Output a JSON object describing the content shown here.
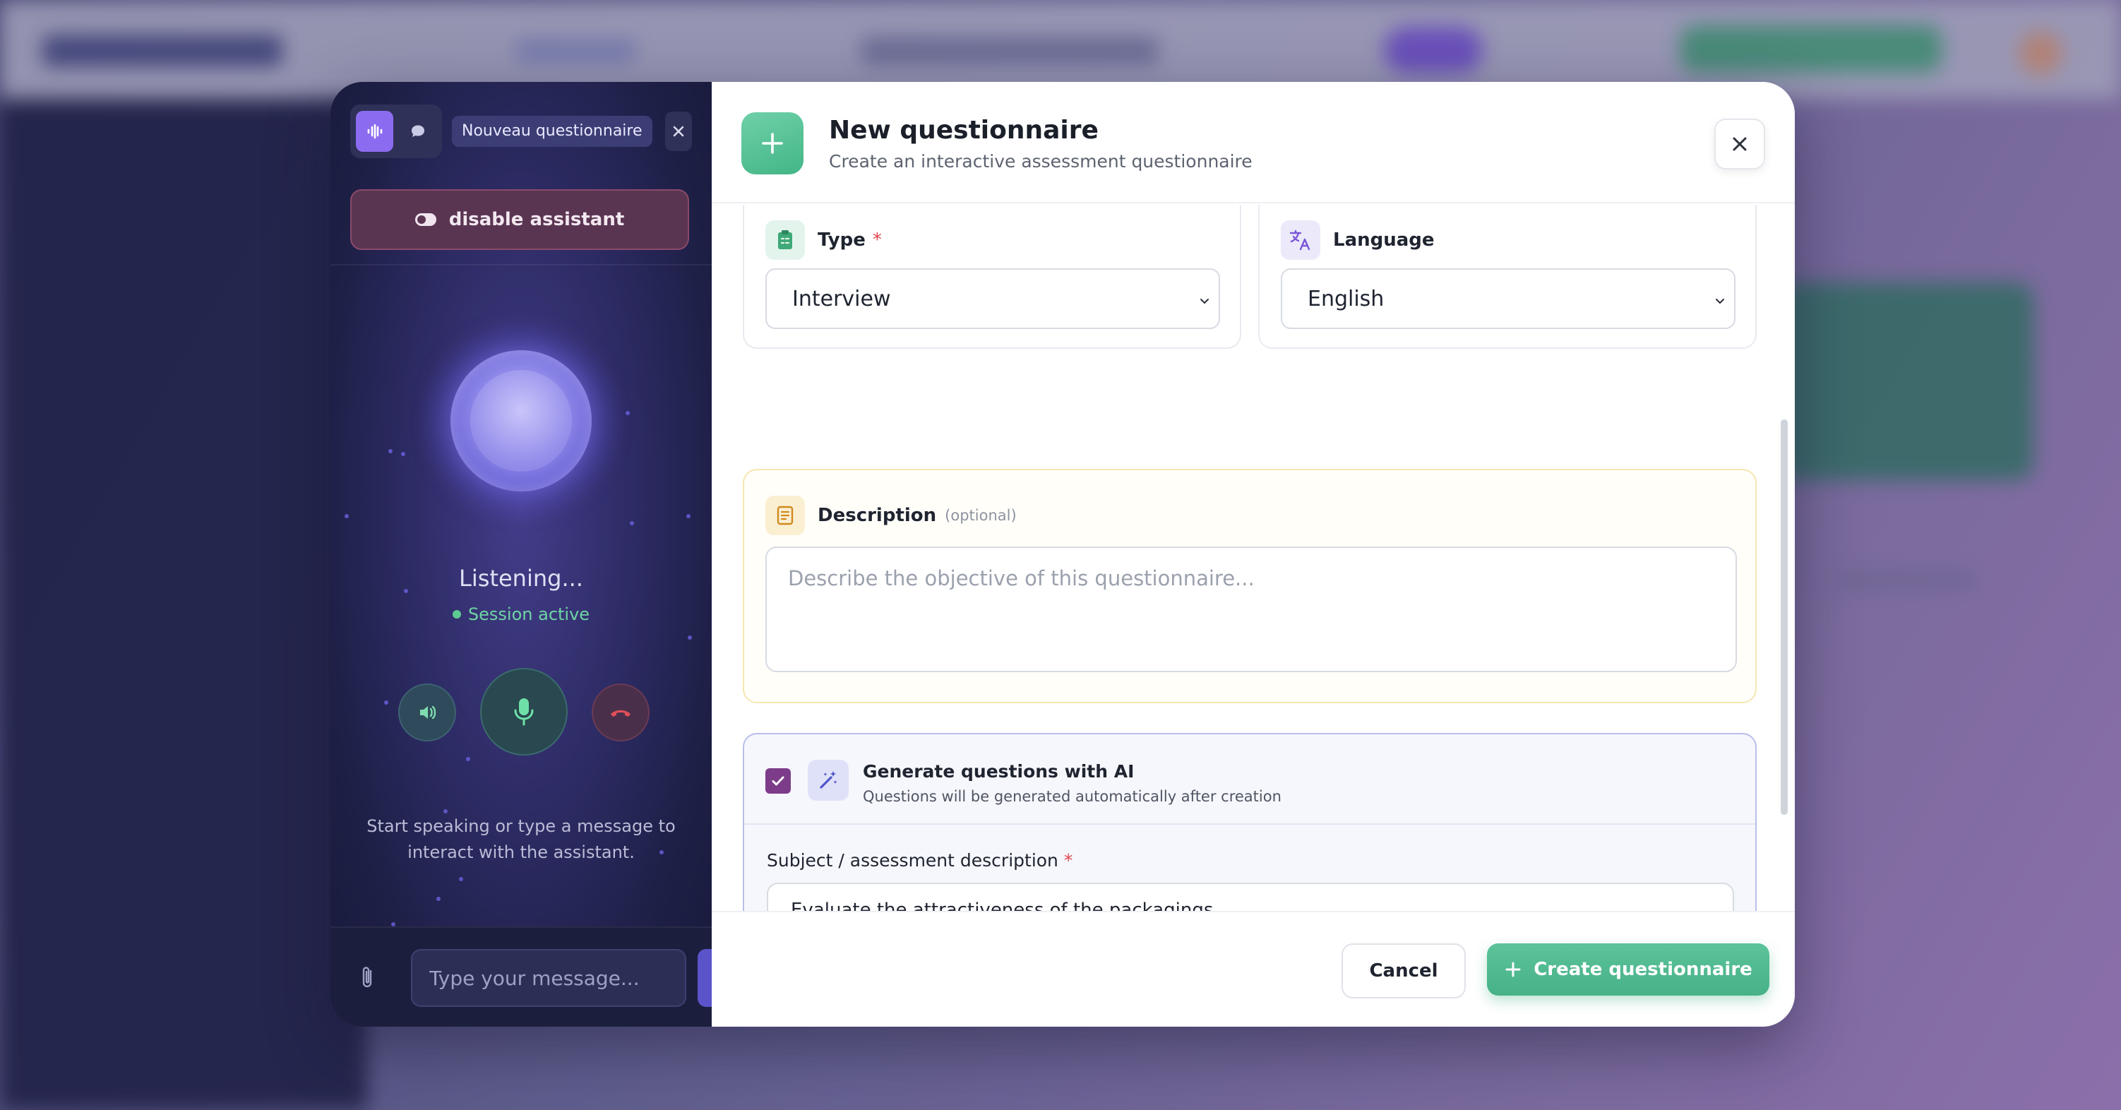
{
  "assistant": {
    "mode_voice_icon": "waveform-icon",
    "mode_chat_icon": "chat-bubble-icon",
    "session_label": "Nouveau questionnaire",
    "disable_label": "disable assistant",
    "status": "Listening...",
    "session_status": "Session active",
    "hint": "Start speaking or type a message to interact with the assistant.",
    "message_placeholder": "Type your message...",
    "colors": {
      "accent": "#8b6cf0",
      "active": "#5ecb93",
      "danger": "#e0505a"
    }
  },
  "form": {
    "title": "New questionnaire",
    "subtitle": "Create an interactive assessment questionnaire",
    "type": {
      "label": "Type",
      "required_mark": "*",
      "value": "Interview"
    },
    "language": {
      "label": "Language",
      "value": "English"
    },
    "description": {
      "label": "Description",
      "optional": "(optional)",
      "placeholder": "Describe the objective of this questionnaire..."
    },
    "ai": {
      "checked": true,
      "title": "Generate questions with AI",
      "subtitle": "Questions will be generated automatically after creation",
      "subject_label": "Subject / assessment description",
      "required_mark": "*",
      "subject_value": "Evaluate the attractiveness of the packagings"
    },
    "cancel_label": "Cancel",
    "create_label": "Create questionnaire",
    "colors": {
      "brand": "#47b187",
      "checkbox": "#7d3c8a",
      "required": "#e2474f"
    }
  }
}
